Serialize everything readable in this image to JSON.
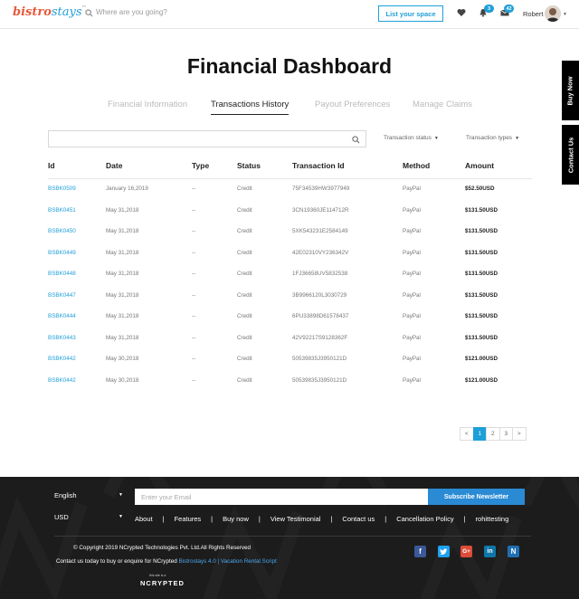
{
  "header": {
    "logo_primary": "bistro",
    "logo_secondary": "stays",
    "logo_tm": "™",
    "search_placeholder": "Where are you going?",
    "list_space_label": "List your space",
    "notifications_count": "3",
    "messages_count": "42",
    "user_name": "Robert"
  },
  "side_buttons": {
    "buy_now": "Buy Now",
    "contact_us": "Contact Us"
  },
  "page_title": "Financial Dashboard",
  "tabs": [
    {
      "label": "Financial Information"
    },
    {
      "label": "Transactions History"
    },
    {
      "label": "Payout Preferences"
    },
    {
      "label": "Manage Claims"
    }
  ],
  "filters": {
    "transaction_status": "Transaction status",
    "transaction_types": "Transaction types"
  },
  "table": {
    "headers": [
      "Id",
      "Date",
      "Type",
      "Status",
      "Transaction Id",
      "Method",
      "Amount"
    ],
    "rows": [
      [
        "BSBK0509",
        "January 16,2019",
        "--",
        "Credit",
        "75F34539HW3977949",
        "PayPal",
        "$52.50USD"
      ],
      [
        "BSBK0451",
        "May 31,2018",
        "--",
        "Credit",
        "3CN19360JE114712R",
        "PayPal",
        "$131.50USD"
      ],
      [
        "BSBK0450",
        "May 31,2018",
        "--",
        "Credit",
        "5XK543231E2584149",
        "PayPal",
        "$131.50USD"
      ],
      [
        "BSBK0449",
        "May 31,2018",
        "--",
        "Credit",
        "42E02310VY236342V",
        "PayPal",
        "$131.50USD"
      ],
      [
        "BSBK0448",
        "May 31,2018",
        "--",
        "Credit",
        "1FJ36658UV5832538",
        "PayPal",
        "$131.50USD"
      ],
      [
        "BSBK0447",
        "May 31,2018",
        "--",
        "Credit",
        "3B9966120L3030729",
        "PayPal",
        "$131.50USD"
      ],
      [
        "BSBK0444",
        "May 31,2018",
        "--",
        "Credit",
        "6PU33898D61578437",
        "PayPal",
        "$131.50USD"
      ],
      [
        "BSBK0443",
        "May 31,2018",
        "--",
        "Credit",
        "42V92217S9128362F",
        "PayPal",
        "$131.50USD"
      ],
      [
        "BSBK0442",
        "May 30,2018",
        "--",
        "Credit",
        "50539835J3950121D",
        "PayPal",
        "$121.00USD"
      ],
      [
        "BSBK0442",
        "May 30,2018",
        "--",
        "Credit",
        "50539835J3950121D",
        "PayPal",
        "$121.00USD"
      ]
    ]
  },
  "pagination": {
    "prev": "<",
    "pages": [
      "1",
      "2",
      "3"
    ],
    "next": ">",
    "current": "1"
  },
  "footer": {
    "language": "English",
    "currency": "USD",
    "email_placeholder": "Enter your Email",
    "subscribe_label": "Subscribe Newsletter",
    "links": [
      "About",
      "Features",
      "Buy now",
      "View Testimonial",
      "Contact us",
      "Cancellation Policy",
      "rohittesting"
    ],
    "copyright": "© Copyright 2019 NCrypted Technologies Pvt. Ltd.All Rights Reserved",
    "contact_prefix": "Contact us today to buy or enquire for NCrypted",
    "contact_link1": "Bistrostays 4.0",
    "contact_sep": "|",
    "contact_link2": "Vacation Rental Script",
    "ncrypted_brand": "NCRYPTED",
    "ncrypted_tagline": "this site is a"
  },
  "colors": {
    "accent": "#1f9fd8",
    "footer_bg": "#1c1c1c",
    "subscribe_bg": "#2a8bd4",
    "logo_red": "#e85a3c"
  }
}
